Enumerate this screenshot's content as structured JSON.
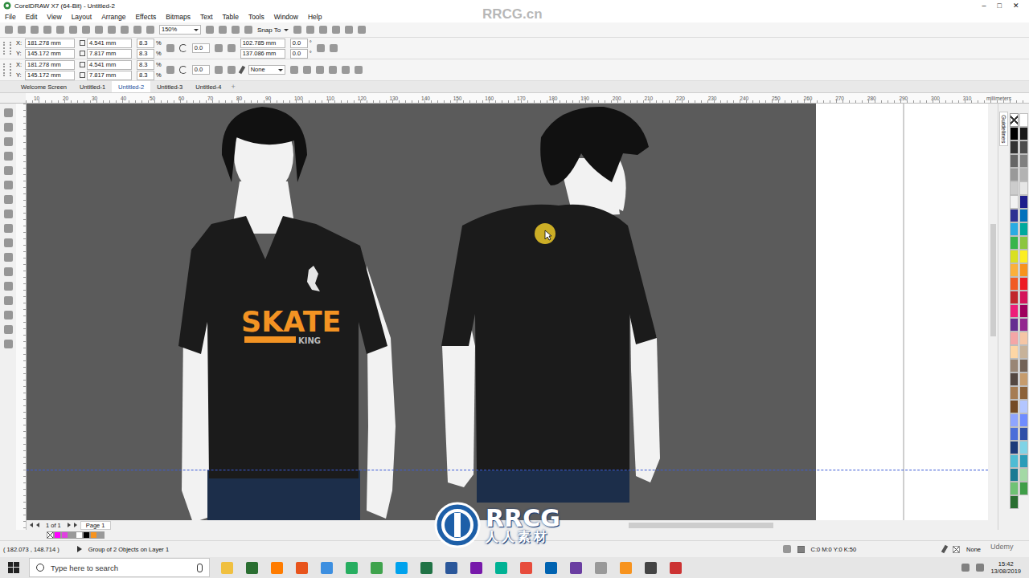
{
  "window": {
    "title": "CorelDRAW X7 (64-Bit) - Untitled-2",
    "controls": [
      "–",
      "□",
      "✕"
    ]
  },
  "watermark": {
    "top": "RRCG.cn",
    "logo": "RRCG",
    "logo_sub": "人人素材",
    "corner": "Udemy"
  },
  "menu": [
    "File",
    "Edit",
    "View",
    "Layout",
    "Arrange",
    "Effects",
    "Bitmaps",
    "Text",
    "Table",
    "Tools",
    "Window",
    "Help"
  ],
  "toolbar": {
    "zoom": "150%",
    "snap": "Snap To"
  },
  "property_bar_1": {
    "x_label": "X:",
    "x": "181.278 mm",
    "y_label": "Y:",
    "y": "145.172 mm",
    "width": "4.541 mm",
    "height": "7.817 mm",
    "scale_x": "8.3",
    "scale_y": "8.3",
    "scale_unit": "%",
    "rotation": "0.0",
    "center_x": "102.785 mm",
    "center_y": "137.086 mm",
    "skew_x": "0.0",
    "skew_y": "0.0",
    "degree": "°"
  },
  "property_bar_2": {
    "x_label": "X:",
    "x": "181.278 mm",
    "y_label": "Y:",
    "y": "145.172 mm",
    "width": "4.541 mm",
    "height": "7.817 mm",
    "scale_x": "8.3",
    "scale_y": "8.3",
    "scale_unit": "%",
    "rotation": "0.0",
    "outline": "None"
  },
  "tabs": [
    {
      "label": "Welcome Screen",
      "selected": false
    },
    {
      "label": "Untitled-1",
      "selected": false
    },
    {
      "label": "Untitled-2",
      "selected": true
    },
    {
      "label": "Untitled-3",
      "selected": false
    },
    {
      "label": "Untitled-4",
      "selected": false
    }
  ],
  "tab_add": "+",
  "ruler": {
    "labels": [
      "10",
      "20",
      "30",
      "40",
      "50",
      "60",
      "70",
      "80",
      "90",
      "100",
      "110",
      "120",
      "130",
      "140",
      "150",
      "160",
      "170",
      "180",
      "190",
      "200",
      "210",
      "220",
      "230",
      "240",
      "250",
      "260",
      "270",
      "280",
      "290",
      "300",
      "310"
    ],
    "unit": "millimeters"
  },
  "docker": {
    "label": "Guidelines"
  },
  "artwork": {
    "headline": "SKATE",
    "subline": "KING"
  },
  "page_nav": {
    "count": "1 of 1",
    "page": "Page 1"
  },
  "palette": [
    "#ffffff",
    "#000000",
    "#1a1a1a",
    "#333333",
    "#4d4d4d",
    "#666666",
    "#808080",
    "#999999",
    "#b3b3b3",
    "#cccccc",
    "#e6e6e6",
    "#f2f2f2",
    "#1d1d8c",
    "#2e3192",
    "#0071bc",
    "#29abe2",
    "#00a99d",
    "#39b54a",
    "#8cc63f",
    "#d9e021",
    "#fcee21",
    "#fbb03b",
    "#f7931e",
    "#f15a24",
    "#ed1c24",
    "#c1272d",
    "#d4145a",
    "#ed1e79",
    "#9e005d",
    "#662d91",
    "#93278f",
    "#f4a6a6",
    "#f5c6a5",
    "#fdd6a5",
    "#c7b299",
    "#998675",
    "#736357",
    "#534741",
    "#c69c6d",
    "#a67c52",
    "#8c6239",
    "#754c24",
    "#b3c6ff",
    "#8fa5ff",
    "#6f8cff",
    "#4a6ed9",
    "#2f4fa8",
    "#1e3a7a",
    "#7fd3e6",
    "#4fbcd4",
    "#2a9cb8",
    "#1a7a94",
    "#a3d9a5",
    "#6fc274",
    "#3f9e48",
    "#2a6e31"
  ],
  "document_palette": [
    "#ff00ff",
    "#e040e0",
    "#999999",
    "#ffffff",
    "#000000",
    "#f7931e",
    "#999999"
  ],
  "status_bar": {
    "coords": "( 182.073 , 148.714 )",
    "info": "Group of 2 Objects on Layer 1",
    "fill": "C:0 M:0 Y:0 K:50",
    "fill_color": "#808080",
    "outline": "None"
  },
  "taskbar": {
    "search": "Type here to search",
    "time": "15:42",
    "date": "13/08/2019",
    "apps": [
      "#f0c040",
      "#2a6e31",
      "#ff7c00",
      "#e8541c",
      "#3d8fe0",
      "#27ae60",
      "#3fa34d",
      "#00a2ed",
      "#217346",
      "#2b579a",
      "#7719aa",
      "#00b294",
      "#e74c3c",
      "#0063b1",
      "#6a3ea1",
      "#999999",
      "#f7931e",
      "#444444",
      "#cc3333"
    ]
  }
}
